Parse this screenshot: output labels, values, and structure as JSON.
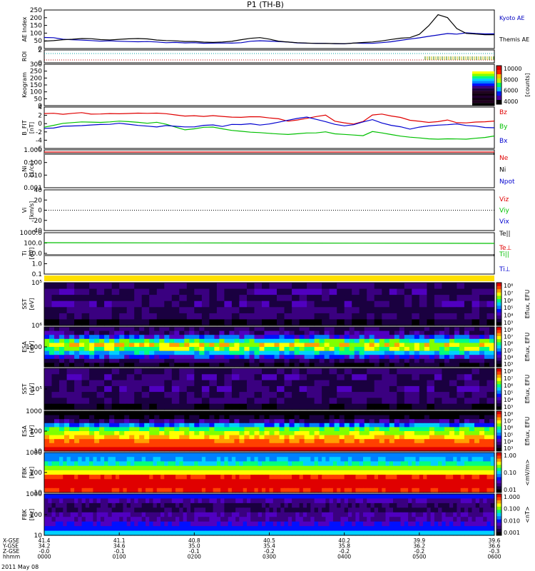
{
  "title": "P1 (TH-B)",
  "date": "2011 May 08",
  "colors": {
    "red": "#e00000",
    "green": "#00d000",
    "blue": "#0000d0",
    "black": "#000000",
    "yellow": "#ffe000"
  },
  "chart_data": [
    {
      "type": "line",
      "name": "ae",
      "ylabel": "AE Index",
      "ylim": [
        0,
        250
      ],
      "yticks": [
        "250",
        "200",
        "150",
        "100",
        "50",
        "0"
      ],
      "series": [
        {
          "name": "Kyoto AE",
          "color": "#0000c0",
          "values": [
            72,
            70,
            62,
            58,
            55,
            52,
            50,
            48,
            47,
            46,
            45,
            44,
            42,
            40,
            40,
            38,
            37,
            36,
            35,
            36,
            37,
            40,
            45,
            48,
            50,
            45,
            40,
            38,
            35,
            34,
            33,
            32,
            32,
            33,
            34,
            35,
            38,
            45,
            55,
            60,
            70,
            80,
            90,
            95,
            95,
            100,
            98,
            96,
            95
          ]
        },
        {
          "name": "Themis AE",
          "color": "#000000",
          "values": [
            48,
            50,
            56,
            62,
            66,
            64,
            60,
            58,
            60,
            62,
            64,
            60,
            56,
            52,
            50,
            46,
            44,
            42,
            40,
            44,
            48,
            56,
            68,
            72,
            60,
            46,
            40,
            36,
            34,
            32,
            32,
            32,
            34,
            36,
            40,
            44,
            50,
            58,
            66,
            72,
            90,
            150,
            220,
            200,
            130,
            100,
            92,
            90,
            88
          ]
        }
      ]
    },
    {
      "type": "bar",
      "name": "roi",
      "ylabel": "ROI",
      "yticks": [
        "2",
        "0"
      ]
    },
    {
      "type": "heatmap",
      "name": "keogram",
      "ylabel": "Keogram",
      "yticks": [
        "300",
        "250",
        "200",
        "150",
        "100",
        "50",
        "0"
      ],
      "colorbar": {
        "label": "[counts]",
        "ticks": [
          "10000",
          "8000",
          "6000",
          "4000"
        ]
      }
    },
    {
      "type": "line",
      "name": "bfield",
      "ylabel": "B_FIT",
      "units": "[nT]",
      "ylim": [
        -6,
        6
      ],
      "yticks": [
        "4",
        "2",
        "0",
        "-2",
        "-4",
        "-6"
      ],
      "series": [
        {
          "name": "Bz",
          "color": "#e00000",
          "values": [
            4.1,
            4.2,
            4.0,
            4.1,
            4.3,
            4.0,
            4.1,
            4.2,
            4.0,
            4.1,
            4.2,
            4.1,
            4.3,
            4.0,
            3.8,
            3.5,
            3.6,
            3.4,
            3.5,
            3.2,
            3.0,
            3.1,
            3.2,
            3.3,
            2.9,
            2.6,
            2.0,
            2.3,
            2.8,
            3.3,
            3.6,
            2.0,
            1.5,
            1.2,
            1.8,
            3.8,
            4.0,
            3.5,
            3.0,
            2.2,
            2.0,
            1.5,
            1.8,
            2.2,
            1.5,
            1.3,
            1.6,
            1.7,
            2.0
          ]
        },
        {
          "name": "By",
          "color": "#00c000",
          "values": [
            0.2,
            0.8,
            1.2,
            1.6,
            1.8,
            1.7,
            1.6,
            1.8,
            1.9,
            1.8,
            1.6,
            1.3,
            1.5,
            1.0,
            0.2,
            -0.5,
            -0.4,
            0.1,
            0.2,
            -0.4,
            -0.8,
            -1.0,
            -1.4,
            -1.5,
            -1.6,
            -1.8,
            -2.0,
            -1.8,
            -1.6,
            -1.5,
            -1.3,
            -1.8,
            -2.0,
            -2.1,
            -2.2,
            -1.2,
            -1.5,
            -2.0,
            -2.4,
            -2.8,
            -3.0,
            -3.2,
            -3.3,
            -3.3,
            -3.3,
            -3.2,
            -3.0,
            -2.8,
            -2.5
          ]
        },
        {
          "name": "Bx",
          "color": "#0000d0",
          "values": [
            -0.2,
            0.0,
            0.4,
            0.6,
            0.7,
            0.8,
            1.0,
            1.1,
            1.2,
            1.0,
            0.8,
            0.5,
            0.3,
            0.6,
            0.5,
            0.2,
            0.3,
            0.6,
            0.8,
            0.4,
            0.9,
            1.0,
            1.2,
            0.8,
            1.0,
            1.6,
            2.3,
            2.8,
            3.1,
            2.5,
            1.8,
            1.0,
            0.6,
            1.0,
            1.8,
            2.3,
            1.4,
            0.7,
            0.2,
            -0.3,
            0.2,
            0.6,
            0.8,
            1.0,
            1.2,
            0.6,
            0.4,
            0.2,
            0.0
          ]
        }
      ]
    },
    {
      "type": "line",
      "name": "density",
      "ylabel": "Ni",
      "units": "[1/cc]",
      "yticks": [
        "1.000",
        "0.100",
        "0.010",
        "0.001"
      ],
      "series": [
        {
          "name": "Ne",
          "color": "#e00000"
        },
        {
          "name": "Ni",
          "color": "#000000"
        },
        {
          "name": "Npot",
          "color": "#0000d0"
        }
      ]
    },
    {
      "type": "line",
      "name": "velocity",
      "ylabel": "Vi",
      "units": "[km/s]",
      "yticks": [
        "40",
        "20",
        "0",
        "-20",
        "-40"
      ],
      "series": [
        {
          "name": "Viz",
          "color": "#e00000"
        },
        {
          "name": "Viy",
          "color": "#00c000"
        },
        {
          "name": "Vix",
          "color": "#0000d0"
        }
      ]
    },
    {
      "type": "line",
      "name": "temp",
      "ylabel": "Ti",
      "units": "[eV]",
      "yticks": [
        "1000.0",
        "100.0",
        "10.0",
        "1.0",
        "0.1"
      ],
      "series": [
        {
          "name": "Te||",
          "color": "#000000"
        },
        {
          "name": "Te⊥",
          "color": "#e00000"
        },
        {
          "name": "Ti||",
          "color": "#00c000"
        },
        {
          "name": "Ti⊥",
          "color": "#0000d0"
        }
      ]
    },
    {
      "type": "heatmap",
      "name": "sst-ion",
      "ylabel": "SST",
      "units": "[eV]",
      "yticks": [
        "10⁵",
        "10⁶"
      ],
      "colorbar": {
        "label": "Eflux, EFU",
        "ticks": [
          "10⁸",
          "10⁷",
          "10⁶",
          "10⁵",
          "10⁴",
          "10³"
        ]
      }
    },
    {
      "type": "heatmap",
      "name": "esa-ion",
      "ylabel": "ESA",
      "units": "[eV]",
      "yticks": [
        "1000"
      ],
      "colorbar": {
        "label": "Eflux, EFU",
        "ticks": [
          "10⁸",
          "10⁷",
          "10⁶",
          "10⁵",
          "10⁴",
          "10³"
        ]
      }
    },
    {
      "type": "heatmap",
      "name": "sst-elec",
      "ylabel": "SST",
      "units": "[eV]",
      "yticks": [
        "10⁵"
      ],
      "colorbar": {
        "label": "Eflux, EFU",
        "ticks": [
          "10⁸",
          "10⁷",
          "10⁶",
          "10⁵",
          "10⁴",
          "10³"
        ]
      }
    },
    {
      "type": "heatmap",
      "name": "esa-elec",
      "ylabel": "ESA",
      "units": "[eV]",
      "yticks": [
        "1000",
        "100",
        "10"
      ],
      "colorbar": {
        "label": "Eflux, EFU",
        "ticks": [
          "10⁸",
          "10⁷",
          "10⁶",
          "10⁵",
          "10⁴",
          "10³"
        ]
      }
    },
    {
      "type": "heatmap",
      "name": "fbk-e",
      "ylabel": "FBK",
      "units": "[Hz]",
      "yticks": [
        "1000",
        "100",
        "10"
      ],
      "colorbar": {
        "label": "<mV/m>",
        "ticks": [
          "1.00",
          "0.10",
          "0.01"
        ]
      }
    },
    {
      "type": "heatmap",
      "name": "fbk-b",
      "ylabel": "FBK",
      "units": "[Hz]",
      "yticks": [
        "1000",
        "100",
        "10"
      ],
      "colorbar": {
        "label": "<nT>",
        "ticks": [
          "1.000",
          "0.100",
          "0.010",
          "0.001"
        ]
      }
    }
  ],
  "xaxis": {
    "rowlabels": [
      "X-GSE",
      "Y-GSE",
      "Z-GSE",
      "hhmm"
    ],
    "columns": [
      [
        "41.4",
        "34.2",
        "-0.0",
        "0000"
      ],
      [
        "41.1",
        "34.6",
        "-0.1",
        "0100"
      ],
      [
        "40.8",
        "35.0",
        "-0.1",
        "0200"
      ],
      [
        "40.5",
        "35.4",
        "-0.2",
        "0300"
      ],
      [
        "40.2",
        "35.8",
        "-0.2",
        "0400"
      ],
      [
        "39.9",
        "36.2",
        "-0.2",
        "0500"
      ],
      [
        "39.6",
        "36.6",
        "-0.3",
        "0600"
      ]
    ]
  }
}
